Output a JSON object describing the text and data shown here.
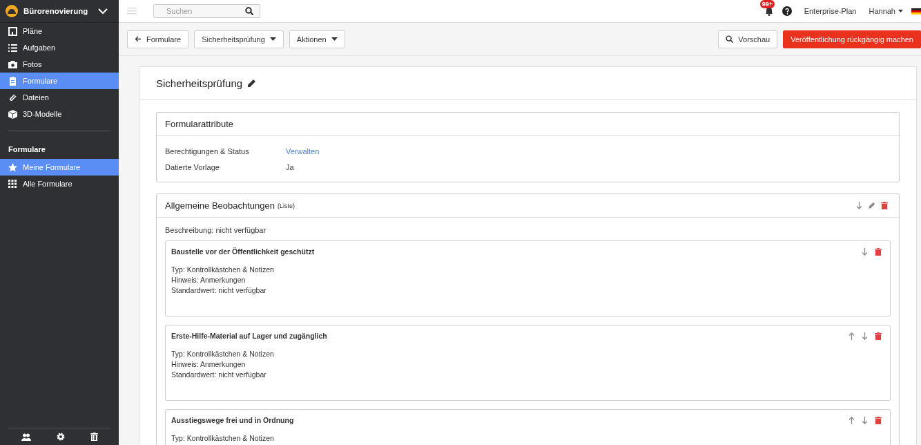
{
  "project": {
    "name": "Bürorenovierung"
  },
  "nav": [
    {
      "label": "Pläne",
      "kind": "plan",
      "selected": false
    },
    {
      "label": "Aufgaben",
      "kind": "list",
      "selected": false
    },
    {
      "label": "Fotos",
      "kind": "camera",
      "selected": false
    },
    {
      "label": "Formulare",
      "kind": "clipboard",
      "selected": true
    },
    {
      "label": "Dateien",
      "kind": "clip",
      "selected": false
    },
    {
      "label": "3D-Modelle",
      "kind": "cube",
      "selected": false
    }
  ],
  "forms_section": {
    "title": "Formulare",
    "items": [
      {
        "label": "Meine Formulare",
        "kind": "star",
        "selected": true
      },
      {
        "label": "Alle Formulare",
        "kind": "grid",
        "selected": false
      }
    ]
  },
  "topbar": {
    "search_placeholder": "Suchen",
    "notification_count": "99+",
    "plan": "Enterprise-Plan",
    "user": "Hannah"
  },
  "toolbar": {
    "back": "Formulare",
    "form_menu": "Sicherheitsprüfung",
    "actions_menu": "Aktionen",
    "preview": "Vorschau",
    "unpublish": "Veröffentlichung rückgängig machen"
  },
  "form": {
    "title": "Sicherheitsprüfung",
    "attributes": {
      "title": "Formularattribute",
      "rows": [
        {
          "label": "Berechtigungen & Status",
          "value": "Verwalten",
          "kind": "link"
        },
        {
          "label": "Datierte Vorlage",
          "value": "Ja",
          "kind": "text"
        }
      ]
    },
    "section": {
      "title": "Allgemeine Beobachtungen",
      "type": "(Liste)",
      "description": "Beschreibung: nicht verfügbar",
      "items": [
        {
          "title": "Baustelle vor der Öffentlichkeit geschützt",
          "can_move_up": false,
          "lines": [
            "Typ: Kontrollkästchen & Notizen",
            "Hinweis: Anmerkungen",
            "Standardwert: nicht verfügbar"
          ]
        },
        {
          "title": "Erste-Hilfe-Material auf Lager und zugänglich",
          "can_move_up": true,
          "lines": [
            "Typ: Kontrollkästchen & Notizen",
            "Hinweis: Anmerkungen",
            "Standardwert: nicht verfügbar"
          ]
        },
        {
          "title": "Ausstiegswege frei und in Ordnung",
          "can_move_up": true,
          "lines": [
            "Typ: Kontrollkästchen & Notizen"
          ]
        }
      ]
    }
  }
}
